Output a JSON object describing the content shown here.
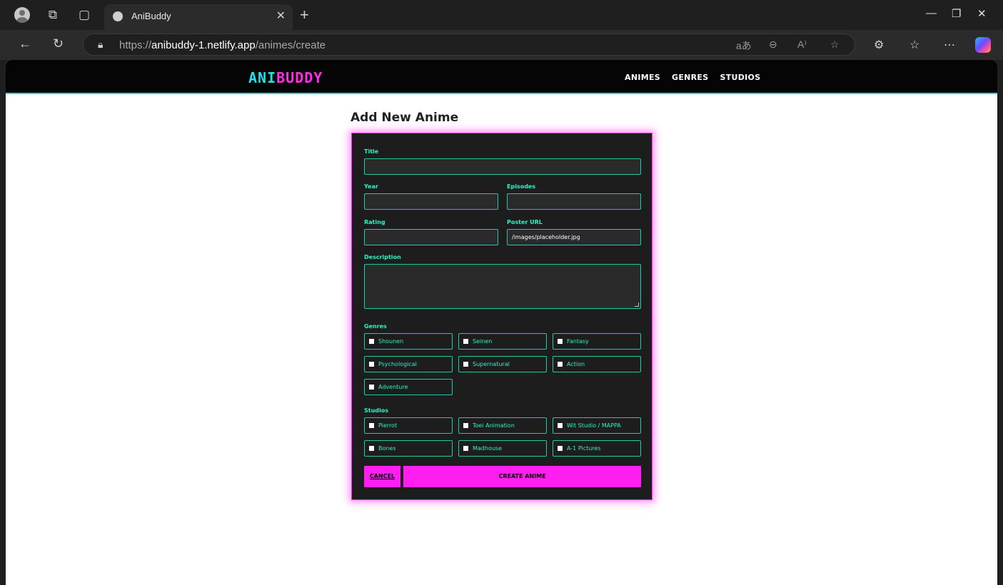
{
  "browser": {
    "tab_title": "AniBuddy",
    "url_scheme": "https://",
    "url_host": "anibuddy-1.netlify.app",
    "url_path": "/animes/create"
  },
  "site": {
    "logo_part1": "ANI",
    "logo_part2": "BUDDY",
    "nav": [
      "ANIMES",
      "GENRES",
      "STUDIOS"
    ]
  },
  "form": {
    "heading": "Add New Anime",
    "labels": {
      "title": "Title",
      "year": "Year",
      "episodes": "Episodes",
      "rating": "Rating",
      "poster": "Poster URL",
      "description": "Description",
      "genres": "Genres",
      "studios": "Studios"
    },
    "values": {
      "title": "",
      "year": "",
      "episodes": "",
      "rating": "",
      "poster": "/images/placeholder.jpg",
      "description": ""
    },
    "genres": [
      "Shounen",
      "Seinen",
      "Fantasy",
      "Psychological",
      "Supernatural",
      "Action",
      "Adventure"
    ],
    "studios": [
      "Pierrot",
      "Toei Animation",
      "Wit Studio / MAPPA",
      "Bones",
      "Madhouse",
      "A-1 Pictures"
    ],
    "cancel_label": "CANCEL",
    "create_label": "CREATE ANIME"
  }
}
